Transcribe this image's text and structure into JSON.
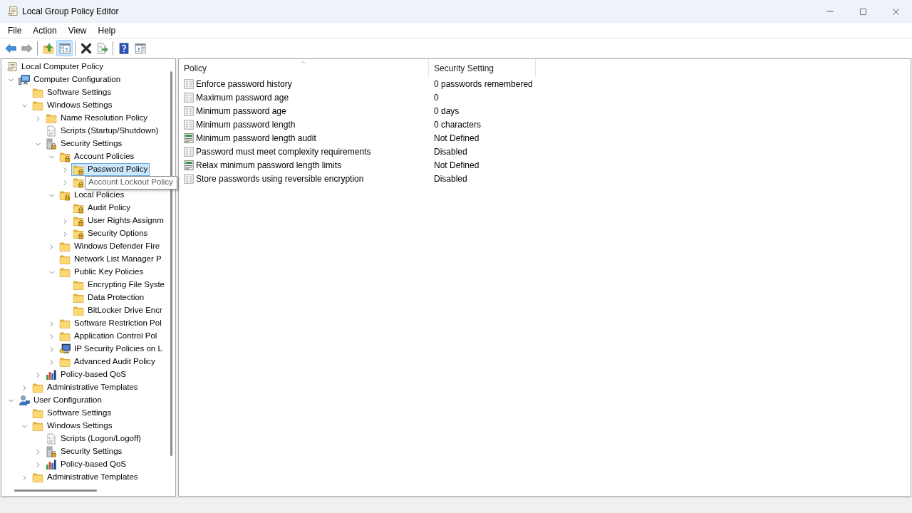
{
  "window": {
    "title": "Local Group Policy Editor"
  },
  "menu": [
    "File",
    "Action",
    "View",
    "Help"
  ],
  "toolbar": {
    "groups": [
      [
        {
          "kind": "back",
          "disabled": false,
          "pressed": false
        },
        {
          "kind": "forward",
          "disabled": true,
          "pressed": false
        }
      ],
      [
        {
          "kind": "up",
          "disabled": false,
          "pressed": false
        },
        {
          "kind": "console-tree",
          "disabled": false,
          "pressed": true
        }
      ],
      [
        {
          "kind": "delete",
          "disabled": false,
          "pressed": false
        },
        {
          "kind": "export",
          "disabled": false,
          "pressed": false
        }
      ],
      [
        {
          "kind": "help",
          "disabled": false,
          "pressed": false
        },
        {
          "kind": "action-pane",
          "disabled": false,
          "pressed": false
        }
      ]
    ]
  },
  "tree": {
    "items": [
      {
        "label": "Local Computer Policy",
        "kind": "policy",
        "selected": false,
        "hovered": false,
        "children": [
          {
            "label": "Computer Configuration",
            "kind": "computer",
            "expanded": true,
            "selected": false,
            "hovered": false,
            "children": [
              {
                "label": "Software Settings",
                "kind": "folder",
                "selected": false,
                "hovered": false
              },
              {
                "label": "Windows Settings",
                "kind": "folder",
                "expanded": true,
                "selected": false,
                "hovered": false,
                "children": [
                  {
                    "label": "Name Resolution Policy",
                    "kind": "folder",
                    "expanded": false,
                    "selected": false,
                    "hovered": false
                  },
                  {
                    "label": "Scripts (Startup/Shutdown)",
                    "kind": "script",
                    "selected": false,
                    "hovered": false
                  },
                  {
                    "label": "Security Settings",
                    "kind": "security",
                    "expanded": true,
                    "selected": false,
                    "hovered": false,
                    "children": [
                      {
                        "label": "Account Policies",
                        "kind": "locked-folder",
                        "expanded": true,
                        "selected": false,
                        "hovered": false,
                        "children": [
                          {
                            "label": "Password Policy",
                            "kind": "locked-folder",
                            "expanded": false,
                            "selected": true,
                            "hovered": false
                          },
                          {
                            "label": "Account Lockout Policy",
                            "kind": "locked-folder",
                            "expanded": false,
                            "selected": false,
                            "hovered": true
                          }
                        ]
                      },
                      {
                        "label": "Local Policies",
                        "kind": "locked-folder",
                        "expanded": true,
                        "selected": false,
                        "hovered": false,
                        "children": [
                          {
                            "label": "Audit Policy",
                            "kind": "locked-folder",
                            "selected": false,
                            "hovered": false
                          },
                          {
                            "label": "User Rights Assignm",
                            "kind": "locked-folder",
                            "expanded": false,
                            "selected": false,
                            "hovered": false
                          },
                          {
                            "label": "Security Options",
                            "kind": "locked-folder",
                            "expanded": false,
                            "selected": false,
                            "hovered": false
                          }
                        ]
                      },
                      {
                        "label": "Windows Defender Fire",
                        "kind": "folder",
                        "expanded": false,
                        "selected": false,
                        "hovered": false
                      },
                      {
                        "label": "Network List Manager P",
                        "kind": "folder",
                        "selected": false,
                        "hovered": false
                      },
                      {
                        "label": "Public Key Policies",
                        "kind": "folder",
                        "expanded": true,
                        "selected": false,
                        "hovered": false,
                        "children": [
                          {
                            "label": "Encrypting File Syste",
                            "kind": "folder",
                            "selected": false,
                            "hovered": false
                          },
                          {
                            "label": "Data Protection",
                            "kind": "folder",
                            "selected": false,
                            "hovered": false
                          },
                          {
                            "label": "BitLocker Drive Encr",
                            "kind": "folder",
                            "selected": false,
                            "hovered": false
                          }
                        ]
                      },
                      {
                        "label": "Software Restriction Pol",
                        "kind": "folder",
                        "expanded": false,
                        "selected": false,
                        "hovered": false
                      },
                      {
                        "label": "Application Control Pol",
                        "kind": "folder",
                        "expanded": false,
                        "selected": false,
                        "hovered": false
                      },
                      {
                        "label": "IP Security Policies on L",
                        "kind": "ip-security",
                        "expanded": false,
                        "selected": false,
                        "hovered": false
                      },
                      {
                        "label": "Advanced Audit Policy",
                        "kind": "folder",
                        "expanded": false,
                        "selected": false,
                        "hovered": false
                      }
                    ]
                  },
                  {
                    "label": "Policy-based QoS",
                    "kind": "qos",
                    "expanded": false,
                    "selected": false,
                    "hovered": false
                  }
                ]
              },
              {
                "label": "Administrative Templates",
                "kind": "folder",
                "expanded": false,
                "selected": false,
                "hovered": false
              }
            ]
          },
          {
            "label": "User Configuration",
            "kind": "user",
            "expanded": true,
            "selected": false,
            "hovered": false,
            "children": [
              {
                "label": "Software Settings",
                "kind": "folder",
                "selected": false,
                "hovered": false
              },
              {
                "label": "Windows Settings",
                "kind": "folder",
                "expanded": true,
                "selected": false,
                "hovered": false,
                "children": [
                  {
                    "label": "Scripts (Logon/Logoff)",
                    "kind": "script",
                    "selected": false,
                    "hovered": false
                  },
                  {
                    "label": "Security Settings",
                    "kind": "security",
                    "expanded": false,
                    "selected": false,
                    "hovered": false
                  },
                  {
                    "label": "Policy-based QoS",
                    "kind": "qos",
                    "expanded": false,
                    "selected": false,
                    "hovered": false
                  }
                ]
              },
              {
                "label": "Administrative Templates",
                "kind": "folder",
                "expanded": false,
                "selected": false,
                "hovered": false
              }
            ]
          }
        ]
      }
    ]
  },
  "list": {
    "columns": [
      {
        "label": "Policy",
        "sorted": true
      },
      {
        "label": "Security Setting",
        "sorted": false
      }
    ],
    "rows": [
      {
        "kind": "policy",
        "policy": "Enforce password history",
        "setting": "0 passwords remembered"
      },
      {
        "kind": "policy",
        "policy": "Maximum password age",
        "setting": "0"
      },
      {
        "kind": "policy",
        "policy": "Minimum password age",
        "setting": "0 days"
      },
      {
        "kind": "policy",
        "policy": "Minimum password length",
        "setting": "0 characters"
      },
      {
        "kind": "audit",
        "policy": "Minimum password length audit",
        "setting": "Not Defined"
      },
      {
        "kind": "policy",
        "policy": "Password must meet complexity requirements",
        "setting": "Disabled"
      },
      {
        "kind": "audit",
        "policy": "Relax minimum password length limits",
        "setting": "Not Defined"
      },
      {
        "kind": "policy",
        "policy": "Store passwords using reversible encryption",
        "setting": "Disabled"
      }
    ]
  }
}
